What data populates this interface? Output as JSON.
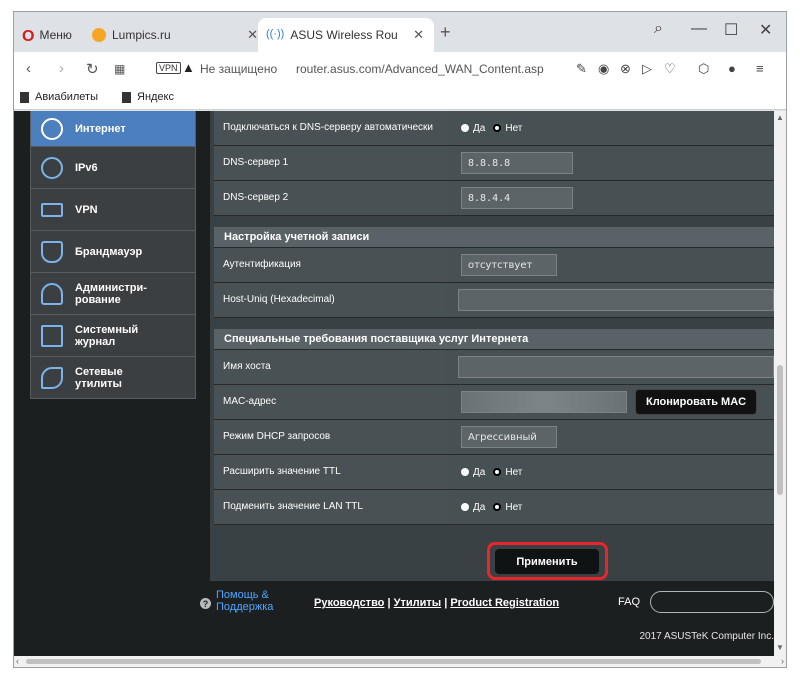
{
  "browser": {
    "tabs": [
      {
        "label": "Меню",
        "icon": "opera-logo-icon"
      },
      {
        "label": "Lumpics.ru",
        "icon": "lumpics-favicon-icon"
      },
      {
        "label": "ASUS Wireless Router RT-N",
        "icon": "asus-wireless-favicon-icon"
      }
    ],
    "new_tab": "+",
    "security_text": "Не защищено",
    "url": "router.asus.com/Advanced_WAN_Content.asp",
    "vpn_badge": "VPN",
    "bookmarks": [
      {
        "label": "Авиабилеты"
      },
      {
        "label": "Яндекс"
      }
    ]
  },
  "menu": {
    "items": [
      {
        "label": "Интернет",
        "icon": "globe-icon",
        "active": true
      },
      {
        "label": "IPv6",
        "icon": "ipv6-icon"
      },
      {
        "label": "VPN",
        "icon": "vpn-icon"
      },
      {
        "label": "Брандмауэр",
        "icon": "shield-icon"
      },
      {
        "label": "Администри-\nрование",
        "icon": "admin-user-icon"
      },
      {
        "label": "Системный\nжурнал",
        "icon": "log-edit-icon"
      },
      {
        "label": "Сетевые\nутилиты",
        "icon": "tools-icon"
      }
    ]
  },
  "settings": {
    "dns_auto": {
      "label": "Подключаться к DNS-серверу автоматически",
      "yes": "Да",
      "no": "Нет",
      "selected": "Нет"
    },
    "dns1": {
      "label": "DNS-сервер 1",
      "value": "8.8.8.8"
    },
    "dns2": {
      "label": "DNS-сервер 2",
      "value": "8.8.4.4"
    },
    "account_section": "Настройка учетной записи",
    "auth": {
      "label": "Аутентификация",
      "value": "отсутствует"
    },
    "host_uniq": {
      "label": "Host-Uniq (Hexadecimal)",
      "value": ""
    },
    "isp_section": "Специальные требования поставщика услуг Интернета",
    "hostname": {
      "label": "Имя хоста",
      "value": ""
    },
    "mac": {
      "label": "MAC-адрес",
      "clone_button": "Клонировать MAC"
    },
    "dhcp_mode": {
      "label": "Режим DHCP запросов",
      "value": "Агрессивный"
    },
    "extend_ttl": {
      "label": "Расширить значение TTL",
      "yes": "Да",
      "no": "Нет",
      "selected": "Нет"
    },
    "spoof_lan_ttl": {
      "label": "Подменить значение LAN TTL",
      "yes": "Да",
      "no": "Нет",
      "selected": "Нет"
    },
    "apply_button": "Применить"
  },
  "footer": {
    "help": "Помощь &\nПоддержка",
    "links": [
      "Руководство",
      "Утилиты",
      "Product Registration"
    ],
    "separator": " | ",
    "faq": "FAQ",
    "copyright": "2017 ASUSTeK Computer Inc."
  }
}
